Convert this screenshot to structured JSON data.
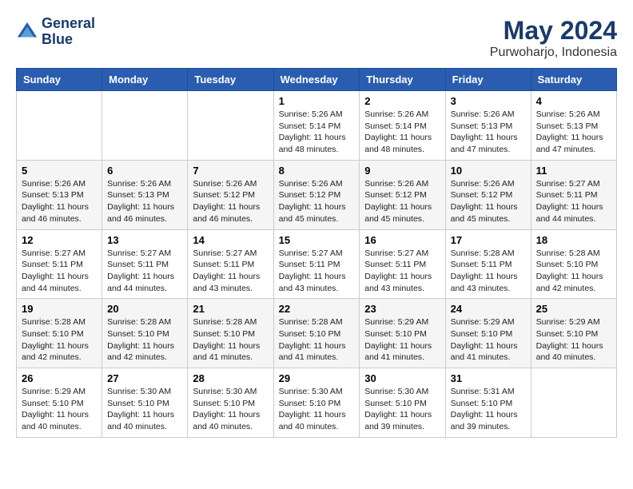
{
  "header": {
    "logo_line1": "General",
    "logo_line2": "Blue",
    "month": "May 2024",
    "location": "Purwoharjo, Indonesia"
  },
  "weekdays": [
    "Sunday",
    "Monday",
    "Tuesday",
    "Wednesday",
    "Thursday",
    "Friday",
    "Saturday"
  ],
  "weeks": [
    [
      {
        "day": "",
        "sunrise": "",
        "sunset": "",
        "daylight": ""
      },
      {
        "day": "",
        "sunrise": "",
        "sunset": "",
        "daylight": ""
      },
      {
        "day": "",
        "sunrise": "",
        "sunset": "",
        "daylight": ""
      },
      {
        "day": "1",
        "sunrise": "Sunrise: 5:26 AM",
        "sunset": "Sunset: 5:14 PM",
        "daylight": "Daylight: 11 hours and 48 minutes."
      },
      {
        "day": "2",
        "sunrise": "Sunrise: 5:26 AM",
        "sunset": "Sunset: 5:14 PM",
        "daylight": "Daylight: 11 hours and 48 minutes."
      },
      {
        "day": "3",
        "sunrise": "Sunrise: 5:26 AM",
        "sunset": "Sunset: 5:13 PM",
        "daylight": "Daylight: 11 hours and 47 minutes."
      },
      {
        "day": "4",
        "sunrise": "Sunrise: 5:26 AM",
        "sunset": "Sunset: 5:13 PM",
        "daylight": "Daylight: 11 hours and 47 minutes."
      }
    ],
    [
      {
        "day": "5",
        "sunrise": "Sunrise: 5:26 AM",
        "sunset": "Sunset: 5:13 PM",
        "daylight": "Daylight: 11 hours and 46 minutes."
      },
      {
        "day": "6",
        "sunrise": "Sunrise: 5:26 AM",
        "sunset": "Sunset: 5:13 PM",
        "daylight": "Daylight: 11 hours and 46 minutes."
      },
      {
        "day": "7",
        "sunrise": "Sunrise: 5:26 AM",
        "sunset": "Sunset: 5:12 PM",
        "daylight": "Daylight: 11 hours and 46 minutes."
      },
      {
        "day": "8",
        "sunrise": "Sunrise: 5:26 AM",
        "sunset": "Sunset: 5:12 PM",
        "daylight": "Daylight: 11 hours and 45 minutes."
      },
      {
        "day": "9",
        "sunrise": "Sunrise: 5:26 AM",
        "sunset": "Sunset: 5:12 PM",
        "daylight": "Daylight: 11 hours and 45 minutes."
      },
      {
        "day": "10",
        "sunrise": "Sunrise: 5:26 AM",
        "sunset": "Sunset: 5:12 PM",
        "daylight": "Daylight: 11 hours and 45 minutes."
      },
      {
        "day": "11",
        "sunrise": "Sunrise: 5:27 AM",
        "sunset": "Sunset: 5:11 PM",
        "daylight": "Daylight: 11 hours and 44 minutes."
      }
    ],
    [
      {
        "day": "12",
        "sunrise": "Sunrise: 5:27 AM",
        "sunset": "Sunset: 5:11 PM",
        "daylight": "Daylight: 11 hours and 44 minutes."
      },
      {
        "day": "13",
        "sunrise": "Sunrise: 5:27 AM",
        "sunset": "Sunset: 5:11 PM",
        "daylight": "Daylight: 11 hours and 44 minutes."
      },
      {
        "day": "14",
        "sunrise": "Sunrise: 5:27 AM",
        "sunset": "Sunset: 5:11 PM",
        "daylight": "Daylight: 11 hours and 43 minutes."
      },
      {
        "day": "15",
        "sunrise": "Sunrise: 5:27 AM",
        "sunset": "Sunset: 5:11 PM",
        "daylight": "Daylight: 11 hours and 43 minutes."
      },
      {
        "day": "16",
        "sunrise": "Sunrise: 5:27 AM",
        "sunset": "Sunset: 5:11 PM",
        "daylight": "Daylight: 11 hours and 43 minutes."
      },
      {
        "day": "17",
        "sunrise": "Sunrise: 5:28 AM",
        "sunset": "Sunset: 5:11 PM",
        "daylight": "Daylight: 11 hours and 43 minutes."
      },
      {
        "day": "18",
        "sunrise": "Sunrise: 5:28 AM",
        "sunset": "Sunset: 5:10 PM",
        "daylight": "Daylight: 11 hours and 42 minutes."
      }
    ],
    [
      {
        "day": "19",
        "sunrise": "Sunrise: 5:28 AM",
        "sunset": "Sunset: 5:10 PM",
        "daylight": "Daylight: 11 hours and 42 minutes."
      },
      {
        "day": "20",
        "sunrise": "Sunrise: 5:28 AM",
        "sunset": "Sunset: 5:10 PM",
        "daylight": "Daylight: 11 hours and 42 minutes."
      },
      {
        "day": "21",
        "sunrise": "Sunrise: 5:28 AM",
        "sunset": "Sunset: 5:10 PM",
        "daylight": "Daylight: 11 hours and 41 minutes."
      },
      {
        "day": "22",
        "sunrise": "Sunrise: 5:28 AM",
        "sunset": "Sunset: 5:10 PM",
        "daylight": "Daylight: 11 hours and 41 minutes."
      },
      {
        "day": "23",
        "sunrise": "Sunrise: 5:29 AM",
        "sunset": "Sunset: 5:10 PM",
        "daylight": "Daylight: 11 hours and 41 minutes."
      },
      {
        "day": "24",
        "sunrise": "Sunrise: 5:29 AM",
        "sunset": "Sunset: 5:10 PM",
        "daylight": "Daylight: 11 hours and 41 minutes."
      },
      {
        "day": "25",
        "sunrise": "Sunrise: 5:29 AM",
        "sunset": "Sunset: 5:10 PM",
        "daylight": "Daylight: 11 hours and 40 minutes."
      }
    ],
    [
      {
        "day": "26",
        "sunrise": "Sunrise: 5:29 AM",
        "sunset": "Sunset: 5:10 PM",
        "daylight": "Daylight: 11 hours and 40 minutes."
      },
      {
        "day": "27",
        "sunrise": "Sunrise: 5:30 AM",
        "sunset": "Sunset: 5:10 PM",
        "daylight": "Daylight: 11 hours and 40 minutes."
      },
      {
        "day": "28",
        "sunrise": "Sunrise: 5:30 AM",
        "sunset": "Sunset: 5:10 PM",
        "daylight": "Daylight: 11 hours and 40 minutes."
      },
      {
        "day": "29",
        "sunrise": "Sunrise: 5:30 AM",
        "sunset": "Sunset: 5:10 PM",
        "daylight": "Daylight: 11 hours and 40 minutes."
      },
      {
        "day": "30",
        "sunrise": "Sunrise: 5:30 AM",
        "sunset": "Sunset: 5:10 PM",
        "daylight": "Daylight: 11 hours and 39 minutes."
      },
      {
        "day": "31",
        "sunrise": "Sunrise: 5:31 AM",
        "sunset": "Sunset: 5:10 PM",
        "daylight": "Daylight: 11 hours and 39 minutes."
      },
      {
        "day": "",
        "sunrise": "",
        "sunset": "",
        "daylight": ""
      }
    ]
  ]
}
